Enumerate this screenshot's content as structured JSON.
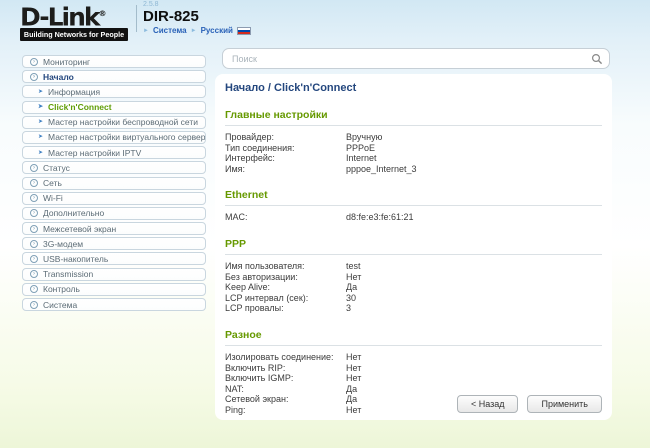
{
  "header": {
    "logo_text": "D-Link",
    "logo_reg": "®",
    "logo_tagline": "Building Networks for People",
    "version": "2.5.8",
    "model": "DIR-825",
    "nav": [
      {
        "label": "Система"
      },
      {
        "label": "Русский"
      }
    ],
    "flag": "russia-flag"
  },
  "search": {
    "placeholder": "Поиск"
  },
  "breadcrumb": {
    "parent": "Начало /",
    "current": "Click'n'Connect"
  },
  "sidebar": {
    "items": [
      {
        "label": "Мониторинг",
        "type": "top",
        "active": false
      },
      {
        "label": "Начало",
        "type": "top",
        "active": true
      },
      {
        "label": "Информация",
        "type": "sub",
        "active": false
      },
      {
        "label": "Click'n'Connect",
        "type": "sub",
        "active": true
      },
      {
        "label": "Мастер настройки беспроводной сети",
        "type": "sub",
        "active": false
      },
      {
        "label": "Мастер настройки виртуального сервера",
        "type": "sub",
        "active": false
      },
      {
        "label": "Мастер настройки IPTV",
        "type": "sub",
        "active": false
      },
      {
        "label": "Статус",
        "type": "top",
        "active": false
      },
      {
        "label": "Сеть",
        "type": "top",
        "active": false
      },
      {
        "label": "Wi-Fi",
        "type": "top",
        "active": false
      },
      {
        "label": "Дополнительно",
        "type": "top",
        "active": false
      },
      {
        "label": "Межсетевой экран",
        "type": "top",
        "active": false
      },
      {
        "label": "3G-модем",
        "type": "top",
        "active": false
      },
      {
        "label": "USB-накопитель",
        "type": "top",
        "active": false
      },
      {
        "label": "Transmission",
        "type": "top",
        "active": false
      },
      {
        "label": "Контроль",
        "type": "top",
        "active": false
      },
      {
        "label": "Система",
        "type": "top",
        "active": false
      }
    ]
  },
  "main": {
    "sections": [
      {
        "title": "Главные настройки",
        "rows": [
          [
            "Провайдер:",
            "Вручную"
          ],
          [
            "Тип соединения:",
            "PPPoE"
          ],
          [
            "Интерфейс:",
            "Internet"
          ],
          [
            "Имя:",
            "pppoe_Internet_3"
          ]
        ]
      },
      {
        "title": "Ethernet",
        "rows": [
          [
            "MAC:",
            "d8:fe:e3:fe:61:21"
          ]
        ]
      },
      {
        "title": "PPP",
        "rows": [
          [
            "Имя пользователя:",
            "test"
          ],
          [
            "Без авторизации:",
            "Нет"
          ],
          [
            "Keep Alive:",
            "Да"
          ],
          [
            "LCP интервал (сек):",
            "30"
          ],
          [
            "LCP провалы:",
            "3"
          ]
        ]
      },
      {
        "title": "Разное",
        "rows": [
          [
            "Изолировать соединение:",
            "Нет"
          ],
          [
            "Включить RIP:",
            "Нет"
          ],
          [
            "Включить IGMP:",
            "Нет"
          ],
          [
            "NAT:",
            "Да"
          ],
          [
            "Сетевой экран:",
            "Да"
          ],
          [
            "Ping:",
            "Нет"
          ]
        ]
      }
    ]
  },
  "buttons": {
    "back": "< Назад",
    "apply": "Применить"
  },
  "colors": {
    "accent_green": "#669900",
    "navy": "#24477e",
    "link_blue": "#2a62b8"
  }
}
